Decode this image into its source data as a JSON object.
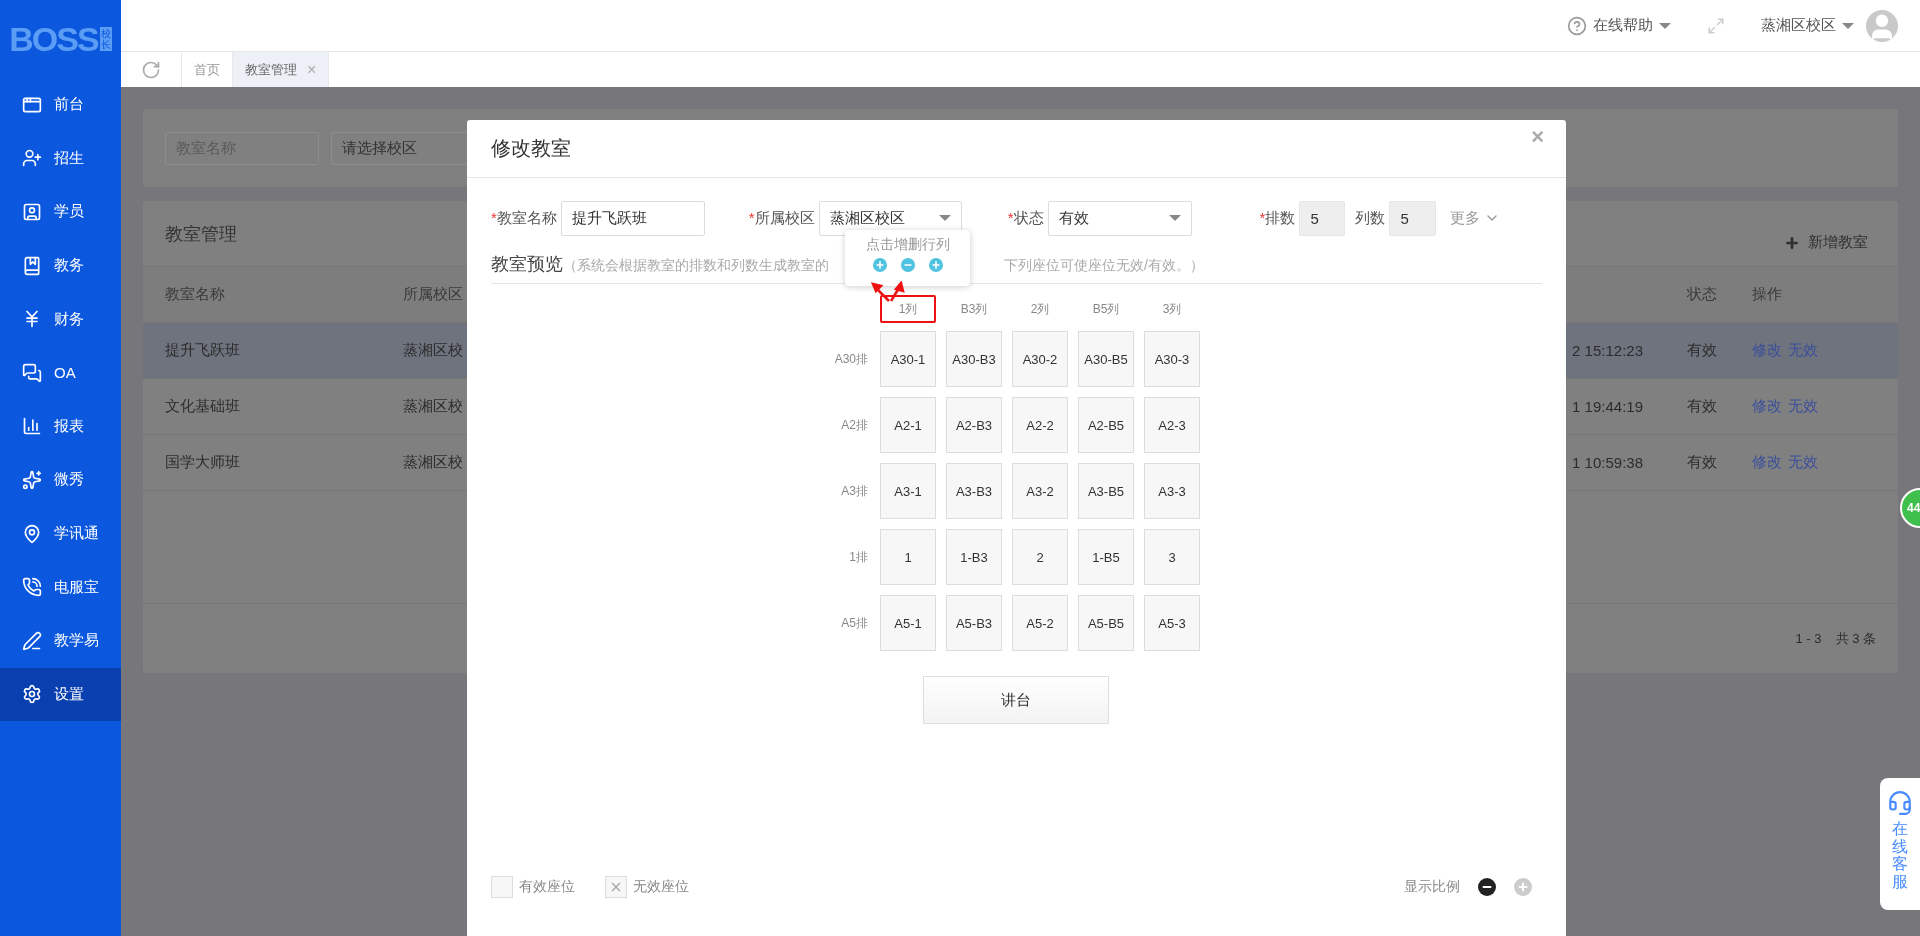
{
  "sidebar": {
    "logo": "BOSS",
    "logo_badge": "校长",
    "items": [
      {
        "label": "前台",
        "selected": false
      },
      {
        "label": "招生",
        "selected": false
      },
      {
        "label": "学员",
        "selected": false
      },
      {
        "label": "教务",
        "selected": false
      },
      {
        "label": "财务",
        "selected": false
      },
      {
        "label": "OA",
        "selected": false
      },
      {
        "label": "报表",
        "selected": false
      },
      {
        "label": "微秀",
        "selected": false
      },
      {
        "label": "学讯通",
        "selected": false
      },
      {
        "label": "电服宝",
        "selected": false
      },
      {
        "label": "教学易",
        "selected": false
      },
      {
        "label": "设置",
        "selected": true
      }
    ]
  },
  "header": {
    "help": "在线帮助",
    "campus": "蒸湘区校区"
  },
  "tabs": [
    {
      "label": "首页",
      "selected": false
    },
    {
      "label": "教室管理",
      "selected": true,
      "close": "×"
    }
  ],
  "page": {
    "filter": {
      "name_placeholder": "教室名称",
      "campus_placeholder": "请选择校区"
    },
    "title": "教室管理",
    "add_button": "新增教室",
    "columns": [
      "教室名称",
      "所属校区",
      "状态",
      "操作"
    ],
    "rows": [
      {
        "name": "提升飞跃班",
        "campus": "蒸湘区校",
        "time": "2 15:12:23",
        "status": "有效",
        "actions": [
          "修改",
          "无效"
        ],
        "selected": true
      },
      {
        "name": "文化基础班",
        "campus": "蒸湘区校",
        "time": "1 19:44:19",
        "status": "有效",
        "actions": [
          "修改",
          "无效"
        ],
        "selected": false
      },
      {
        "name": "国学大师班",
        "campus": "蒸湘区校",
        "time": "1 10:59:38",
        "status": "有效",
        "actions": [
          "修改",
          "无效"
        ],
        "selected": false
      }
    ],
    "pagination": {
      "range": "1 - 3",
      "total": "共 3 条"
    }
  },
  "modal": {
    "title": "修改教室",
    "close": "×",
    "fields": [
      {
        "kind": "input",
        "mark": "*",
        "label": "教室名称",
        "value": "提升飞跃班"
      },
      {
        "kind": "select",
        "mark": "*",
        "label": "所属校区",
        "value": "蒸湘区校区"
      },
      {
        "kind": "select",
        "mark": "*",
        "label": "状态",
        "value": "有效"
      },
      {
        "kind": "readonly",
        "mark": "*",
        "label": "排数",
        "value": "5"
      },
      {
        "kind": "readonly",
        "label": "列数",
        "value": "5"
      }
    ],
    "more": "更多",
    "preview_title": "教室预览",
    "hint_start": "（系统会根据教室的排数和列数生成教室的",
    "hint_end": "下列座位可使座位无效/有效。）",
    "tooltip": "点击增删行列",
    "columns": [
      {
        "label": "1列",
        "highlighted": true
      },
      {
        "label": "B3列",
        "highlighted": false
      },
      {
        "label": "2列",
        "highlighted": false
      },
      {
        "label": "B5列",
        "highlighted": false
      },
      {
        "label": "3列",
        "highlighted": false
      }
    ],
    "rows": [
      {
        "label": "A30排",
        "seats": [
          {
            "label": "A30-1",
            "valid": true
          },
          {
            "label": "A30-B3",
            "valid": true
          },
          {
            "label": "A30-2",
            "valid": true
          },
          {
            "label": "A30-B5",
            "valid": true
          },
          {
            "label": "A30-3",
            "valid": true
          }
        ]
      },
      {
        "label": "A2排",
        "seats": [
          {
            "label": "A2-1",
            "valid": true
          },
          {
            "label": "A2-B3",
            "valid": true
          },
          {
            "label": "A2-2",
            "valid": true
          },
          {
            "label": "A2-B5",
            "valid": true
          },
          {
            "label": "A2-3",
            "valid": true
          }
        ]
      },
      {
        "label": "A3排",
        "seats": [
          {
            "label": "A3-1",
            "valid": true
          },
          {
            "label": "A3-B3",
            "valid": true
          },
          {
            "label": "A3-2",
            "valid": true
          },
          {
            "label": "A3-B5",
            "valid": true
          },
          {
            "label": "A3-3",
            "valid": true
          }
        ]
      },
      {
        "label": "1排",
        "seats": [
          {
            "label": "1",
            "valid": true
          },
          {
            "label": "1-B3",
            "valid": true
          },
          {
            "label": "2",
            "valid": true
          },
          {
            "label": "1-B5",
            "valid": true
          },
          {
            "label": "3",
            "valid": true
          }
        ]
      },
      {
        "label": "A5排",
        "seats": [
          {
            "label": "A5-1",
            "valid": true
          },
          {
            "label": "A5-B3",
            "valid": true
          },
          {
            "label": "A5-2",
            "valid": true
          },
          {
            "label": "A5-B5",
            "valid": true
          },
          {
            "label": "A5-3",
            "valid": true
          }
        ]
      }
    ],
    "podium": "讲台",
    "legend": [
      {
        "label": "有效座位",
        "valid": true
      },
      {
        "label": "无效座位",
        "valid": false
      }
    ],
    "zoom": {
      "label": "显示比例",
      "minus_disabled": false,
      "plus_disabled": true
    }
  },
  "floating": {
    "badge": "44",
    "service": "在线客服"
  }
}
